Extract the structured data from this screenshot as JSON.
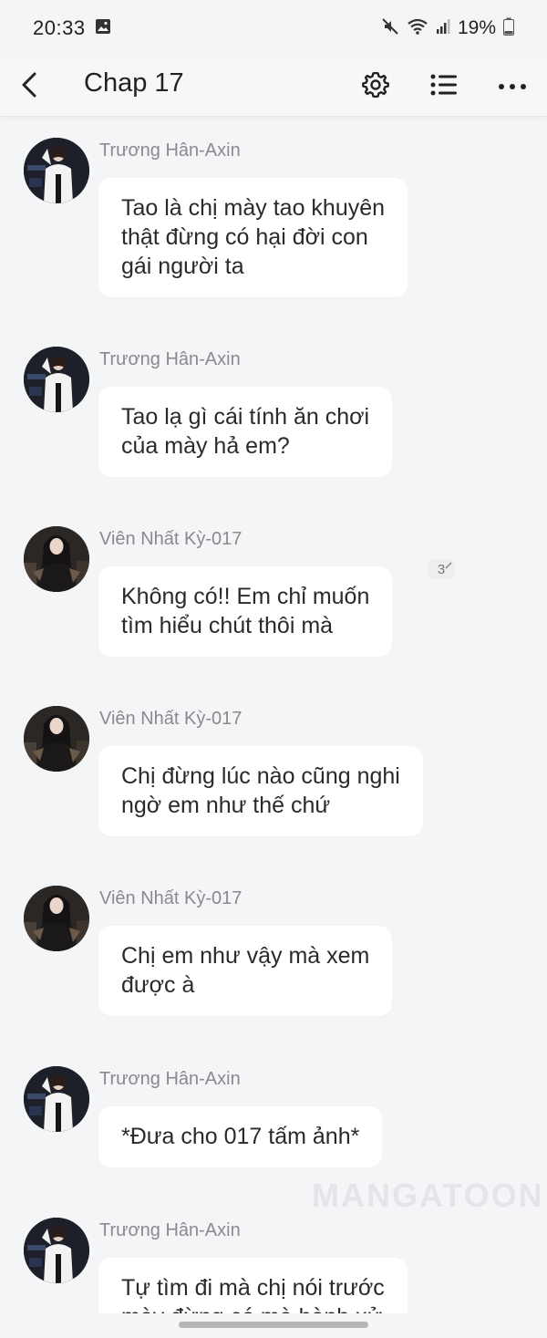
{
  "status_bar": {
    "time": "20:33",
    "battery": "19%",
    "icons": [
      "gallery-icon",
      "mute-icon",
      "wifi-icon",
      "signal-icon",
      "battery-icon"
    ]
  },
  "header": {
    "title": "Chap 17",
    "back_icon": "back-arrow-icon",
    "settings_icon": "gear-icon",
    "list_icon": "list-icon",
    "more_icon": "more-icon"
  },
  "messages": [
    {
      "sender": "Trương Hân-Axin",
      "avatar": "axin",
      "lines": [
        "Tao là chị mày tao khuyên",
        "thật đừng có hại đời con",
        "gái người ta"
      ]
    },
    {
      "sender": "Trương Hân-Axin",
      "avatar": "axin",
      "lines": [
        "Tao lạ gì cái tính ăn chơi",
        "của mày hả em?"
      ]
    },
    {
      "sender": "Viên Nhất Kỳ-017",
      "avatar": "017",
      "lines": [
        "Không có!! Em chỉ muốn",
        "tìm hiểu chút thôi mà"
      ],
      "comment_count": "3"
    },
    {
      "sender": "Viên Nhất Kỳ-017",
      "avatar": "017",
      "lines": [
        "Chị đừng lúc nào cũng nghi",
        "ngờ em như thế chứ"
      ]
    },
    {
      "sender": "Viên Nhất Kỳ-017",
      "avatar": "017",
      "lines": [
        "Chị em như vậy mà xem",
        "được à"
      ]
    },
    {
      "sender": "Trương Hân-Axin",
      "avatar": "axin",
      "lines": [
        "*Đưa cho 017 tấm ảnh*"
      ]
    },
    {
      "sender": "Trương Hân-Axin",
      "avatar": "axin",
      "lines": [
        "Tự tìm đi mà chị nói trước",
        "mày đừng có mà hành xử"
      ]
    }
  ],
  "watermark": "MANGATOON",
  "colors": {
    "background": "#f4f5f7",
    "bubble": "#ffffff",
    "sender": "#8a8a8e",
    "text": "#2a2a2a"
  }
}
